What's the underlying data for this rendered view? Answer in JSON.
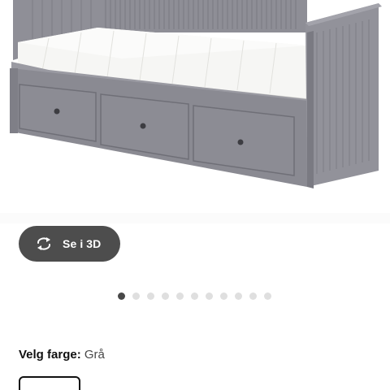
{
  "product": {
    "image_name": "grey daybed with three drawers and white mattress"
  },
  "view_3d": {
    "label": "Se i 3D",
    "icon": "rotate-3d-icon"
  },
  "carousel": {
    "count": 11,
    "active_index": 0
  },
  "color_selector": {
    "label": "Velg farge:",
    "value": "Grå"
  },
  "colors": {
    "button_bg": "#4d4d4d",
    "frame_grey": "#8a8a92",
    "dot_active": "#484848",
    "dot_inactive": "#dfdfdf"
  }
}
